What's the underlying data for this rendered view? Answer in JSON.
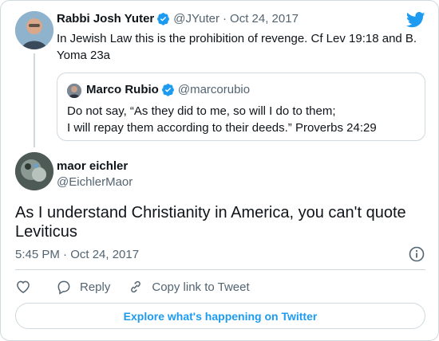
{
  "parent_tweet": {
    "author_name": "Rabbi Josh Yuter",
    "author_handle": "@JYuter",
    "separator": "·",
    "date": "Oct 24, 2017",
    "text": "In Jewish Law this is the prohibition of revenge. Cf Lev 19:18 and B. Yoma 23a"
  },
  "quoted_tweet": {
    "author_name": "Marco Rubio",
    "author_handle": "@marcorubio",
    "line1": "Do not say, “As they did to me, so will I do to them;",
    "line2": "I will repay them according to their deeds.” Proverbs 24:29"
  },
  "main_tweet": {
    "author_name": "maor eichler",
    "author_handle": "@EichlerMaor",
    "text": "As I understand Christianity in America, you can't quote Leviticus",
    "timestamp": "5:45 PM · Oct 24, 2017"
  },
  "actions": {
    "reply_label": "Reply",
    "copy_link_label": "Copy link to Tweet"
  },
  "explore_label": "Explore what's happening on Twitter",
  "icons": {
    "brand": "twitter-bird-icon",
    "verified": "verified-badge-icon",
    "like": "heart-icon",
    "reply": "speech-bubble-icon",
    "copy_link": "link-icon",
    "info": "info-icon"
  },
  "colors": {
    "twitter_blue": "#1d9bf0",
    "text_primary": "#0f1419",
    "text_secondary": "#536471",
    "border": "#cfd9de"
  }
}
